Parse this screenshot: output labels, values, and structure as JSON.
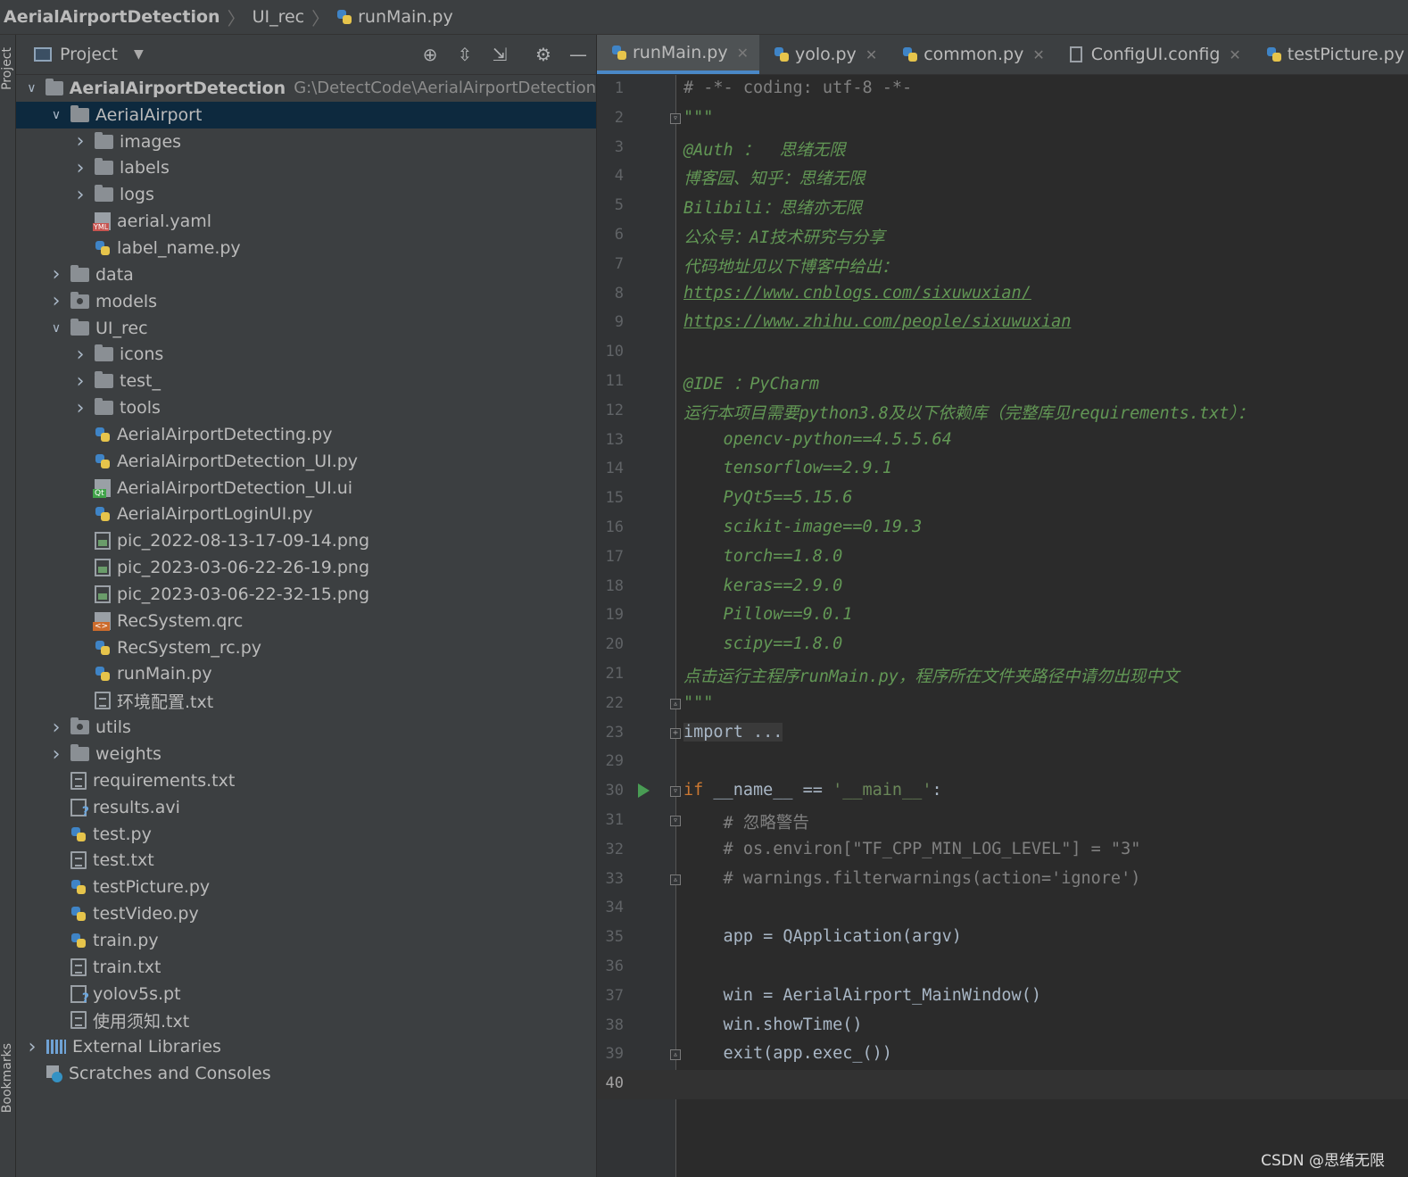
{
  "breadcrumb": {
    "project": "AerialAirportDetection",
    "folder": "UI_rec",
    "file": "runMain.py"
  },
  "side_tabs": {
    "project": "Project",
    "bookmarks": "Bookmarks"
  },
  "project_panel": {
    "title": "Project",
    "tools": [
      "locate-icon",
      "expand-all-icon",
      "collapse-all-icon",
      "gear-icon",
      "minimize-icon"
    ],
    "tree": [
      {
        "depth": 0,
        "expander": "open",
        "icon": "folder-icon",
        "name": "AerialAirportDetection",
        "path": "G:\\DetectCode\\AerialAirportDetection",
        "bold": true
      },
      {
        "depth": 1,
        "expander": "open",
        "icon": "folder-icon",
        "name": "AerialAirport",
        "selected": true
      },
      {
        "depth": 2,
        "expander": "closed",
        "icon": "folder-icon",
        "name": "images"
      },
      {
        "depth": 2,
        "expander": "closed",
        "icon": "folder-icon",
        "name": "labels"
      },
      {
        "depth": 2,
        "expander": "closed",
        "icon": "folder-icon",
        "name": "logs"
      },
      {
        "depth": 2,
        "expander": "none",
        "icon": "yaml-file-icon",
        "name": "aerial.yaml"
      },
      {
        "depth": 2,
        "expander": "none",
        "icon": "python-file-icon",
        "name": "label_name.py"
      },
      {
        "depth": 1,
        "expander": "closed",
        "icon": "folder-icon",
        "name": "data"
      },
      {
        "depth": 1,
        "expander": "closed",
        "icon": "module-folder-icon",
        "name": "models"
      },
      {
        "depth": 1,
        "expander": "open",
        "icon": "folder-icon",
        "name": "UI_rec"
      },
      {
        "depth": 2,
        "expander": "closed",
        "icon": "folder-icon",
        "name": "icons"
      },
      {
        "depth": 2,
        "expander": "closed",
        "icon": "folder-icon",
        "name": "test_"
      },
      {
        "depth": 2,
        "expander": "closed",
        "icon": "folder-icon",
        "name": "tools"
      },
      {
        "depth": 2,
        "expander": "none",
        "icon": "python-file-icon",
        "name": "AerialAirportDetecting.py"
      },
      {
        "depth": 2,
        "expander": "none",
        "icon": "python-file-icon",
        "name": "AerialAirportDetection_UI.py"
      },
      {
        "depth": 2,
        "expander": "none",
        "icon": "qt-ui-file-icon",
        "name": "AerialAirportDetection_UI.ui"
      },
      {
        "depth": 2,
        "expander": "none",
        "icon": "python-file-icon",
        "name": "AerialAirportLoginUI.py"
      },
      {
        "depth": 2,
        "expander": "none",
        "icon": "image-file-icon",
        "name": "pic_2022-08-13-17-09-14.png"
      },
      {
        "depth": 2,
        "expander": "none",
        "icon": "image-file-icon",
        "name": "pic_2023-03-06-22-26-19.png"
      },
      {
        "depth": 2,
        "expander": "none",
        "icon": "image-file-icon",
        "name": "pic_2023-03-06-22-32-15.png"
      },
      {
        "depth": 2,
        "expander": "none",
        "icon": "qrc-file-icon",
        "name": "RecSystem.qrc"
      },
      {
        "depth": 2,
        "expander": "none",
        "icon": "python-file-icon",
        "name": "RecSystem_rc.py"
      },
      {
        "depth": 2,
        "expander": "none",
        "icon": "python-file-icon",
        "name": "runMain.py"
      },
      {
        "depth": 2,
        "expander": "none",
        "icon": "text-file-icon",
        "name": "环境配置.txt"
      },
      {
        "depth": 1,
        "expander": "closed",
        "icon": "module-folder-icon",
        "name": "utils"
      },
      {
        "depth": 1,
        "expander": "closed",
        "icon": "folder-icon",
        "name": "weights"
      },
      {
        "depth": 1,
        "expander": "none",
        "icon": "text-file-icon",
        "name": "requirements.txt"
      },
      {
        "depth": 1,
        "expander": "none",
        "icon": "unknown-file-icon",
        "name": "results.avi"
      },
      {
        "depth": 1,
        "expander": "none",
        "icon": "python-file-icon",
        "name": "test.py"
      },
      {
        "depth": 1,
        "expander": "none",
        "icon": "text-file-icon",
        "name": "test.txt"
      },
      {
        "depth": 1,
        "expander": "none",
        "icon": "python-file-icon",
        "name": "testPicture.py"
      },
      {
        "depth": 1,
        "expander": "none",
        "icon": "python-file-icon",
        "name": "testVideo.py"
      },
      {
        "depth": 1,
        "expander": "none",
        "icon": "python-file-icon",
        "name": "train.py"
      },
      {
        "depth": 1,
        "expander": "none",
        "icon": "text-file-icon",
        "name": "train.txt"
      },
      {
        "depth": 1,
        "expander": "none",
        "icon": "unknown-file-icon",
        "name": "yolov5s.pt"
      },
      {
        "depth": 1,
        "expander": "none",
        "icon": "text-file-icon",
        "name": "使用须知.txt"
      },
      {
        "depth": 0,
        "expander": "closed",
        "icon": "library-icon",
        "name": "External Libraries"
      },
      {
        "depth": 0,
        "expander": "none",
        "icon": "scratches-icon",
        "name": "Scratches and Consoles"
      }
    ]
  },
  "editor": {
    "tabs": [
      {
        "label": "runMain.py",
        "icon": "python-file-icon",
        "active": true
      },
      {
        "label": "yolo.py",
        "icon": "python-file-icon",
        "active": false
      },
      {
        "label": "common.py",
        "icon": "python-file-icon",
        "active": false
      },
      {
        "label": "ConfigUI.config",
        "icon": "config-file-icon",
        "active": false
      },
      {
        "label": "testPicture.py",
        "icon": "python-file-icon",
        "active": false
      }
    ],
    "current_line": "40",
    "lines": [
      {
        "n": "1",
        "segs": [
          {
            "t": "# -*- coding: utf-8 -*-",
            "c": "comment"
          }
        ]
      },
      {
        "n": "2",
        "fold": "open",
        "segs": [
          {
            "t": "\"\"\"",
            "c": "doc"
          }
        ]
      },
      {
        "n": "3",
        "segs": [
          {
            "t": "@Auth ：  思绪无限",
            "c": "doc"
          }
        ]
      },
      {
        "n": "4",
        "segs": [
          {
            "t": "博客园、知乎：思绪无限",
            "c": "doc"
          }
        ]
      },
      {
        "n": "5",
        "segs": [
          {
            "t": "Bilibili：思绪亦无限",
            "c": "doc"
          }
        ]
      },
      {
        "n": "6",
        "segs": [
          {
            "t": "公众号：AI技术研究与分享",
            "c": "doc"
          }
        ]
      },
      {
        "n": "7",
        "segs": [
          {
            "t": "代码地址见以下博客中给出：",
            "c": "doc"
          }
        ]
      },
      {
        "n": "8",
        "segs": [
          {
            "t": "https://www.cnblogs.com/sixuwuxian/",
            "c": "link"
          }
        ]
      },
      {
        "n": "9",
        "segs": [
          {
            "t": "https://www.zhihu.com/people/sixuwuxian",
            "c": "link"
          }
        ]
      },
      {
        "n": "10",
        "segs": []
      },
      {
        "n": "11",
        "segs": [
          {
            "t": "@IDE ：PyCharm",
            "c": "doc"
          }
        ]
      },
      {
        "n": "12",
        "segs": [
          {
            "t": "运行本项目需要python3.8及以下依赖库（完整库见requirements.txt）：",
            "c": "doc"
          }
        ]
      },
      {
        "n": "13",
        "segs": [
          {
            "t": "    opencv-python==4.5.5.64",
            "c": "doc"
          }
        ]
      },
      {
        "n": "14",
        "segs": [
          {
            "t": "    tensorflow==2.9.1",
            "c": "doc"
          }
        ]
      },
      {
        "n": "15",
        "segs": [
          {
            "t": "    PyQt5==5.15.6",
            "c": "doc"
          }
        ]
      },
      {
        "n": "16",
        "segs": [
          {
            "t": "    scikit-image==0.19.3",
            "c": "doc"
          }
        ]
      },
      {
        "n": "17",
        "segs": [
          {
            "t": "    torch==1.8.0",
            "c": "doc"
          }
        ]
      },
      {
        "n": "18",
        "segs": [
          {
            "t": "    keras==2.9.0",
            "c": "doc"
          }
        ]
      },
      {
        "n": "19",
        "segs": [
          {
            "t": "    Pillow==9.0.1",
            "c": "doc"
          }
        ]
      },
      {
        "n": "20",
        "segs": [
          {
            "t": "    scipy==1.8.0",
            "c": "doc"
          }
        ]
      },
      {
        "n": "21",
        "segs": [
          {
            "t": "点击运行主程序runMain.py，程序所在文件夹路径中请勿出现中文",
            "c": "doc"
          }
        ]
      },
      {
        "n": "22",
        "fold": "close",
        "segs": [
          {
            "t": "\"\"\"",
            "c": "doc"
          }
        ]
      },
      {
        "n": "23",
        "fold": "plus",
        "segs": [
          {
            "t": "import ...",
            "c": "folded"
          }
        ]
      },
      {
        "n": "29",
        "segs": []
      },
      {
        "n": "30",
        "run": true,
        "fold": "open",
        "segs": [
          {
            "t": "if",
            "c": "kw"
          },
          {
            "t": " __name__ == ",
            "c": "plain"
          },
          {
            "t": "'__main__'",
            "c": "str"
          },
          {
            "t": ":",
            "c": "plain"
          }
        ]
      },
      {
        "n": "31",
        "fold": "open",
        "segs": [
          {
            "t": "    # 忽略警告",
            "c": "comment"
          }
        ]
      },
      {
        "n": "32",
        "segs": [
          {
            "t": "    # os.environ[\"TF_CPP_MIN_LOG_LEVEL\"] = \"3\"",
            "c": "comment"
          }
        ]
      },
      {
        "n": "33",
        "fold": "close",
        "segs": [
          {
            "t": "    # warnings.filterwarnings(action='ignore')",
            "c": "comment"
          }
        ]
      },
      {
        "n": "34",
        "segs": []
      },
      {
        "n": "35",
        "segs": [
          {
            "t": "    app = QApplication(argv)",
            "c": "plain"
          }
        ]
      },
      {
        "n": "36",
        "segs": []
      },
      {
        "n": "37",
        "segs": [
          {
            "t": "    win = AerialAirport_MainWindow()",
            "c": "plain"
          }
        ]
      },
      {
        "n": "38",
        "segs": [
          {
            "t": "    win.showTime()",
            "c": "plain"
          }
        ]
      },
      {
        "n": "39",
        "fold": "close",
        "segs": [
          {
            "t": "    exit(app.exec_())",
            "c": "plain"
          }
        ]
      },
      {
        "n": "40",
        "segs": []
      }
    ]
  },
  "watermark": "CSDN @思绪无限"
}
